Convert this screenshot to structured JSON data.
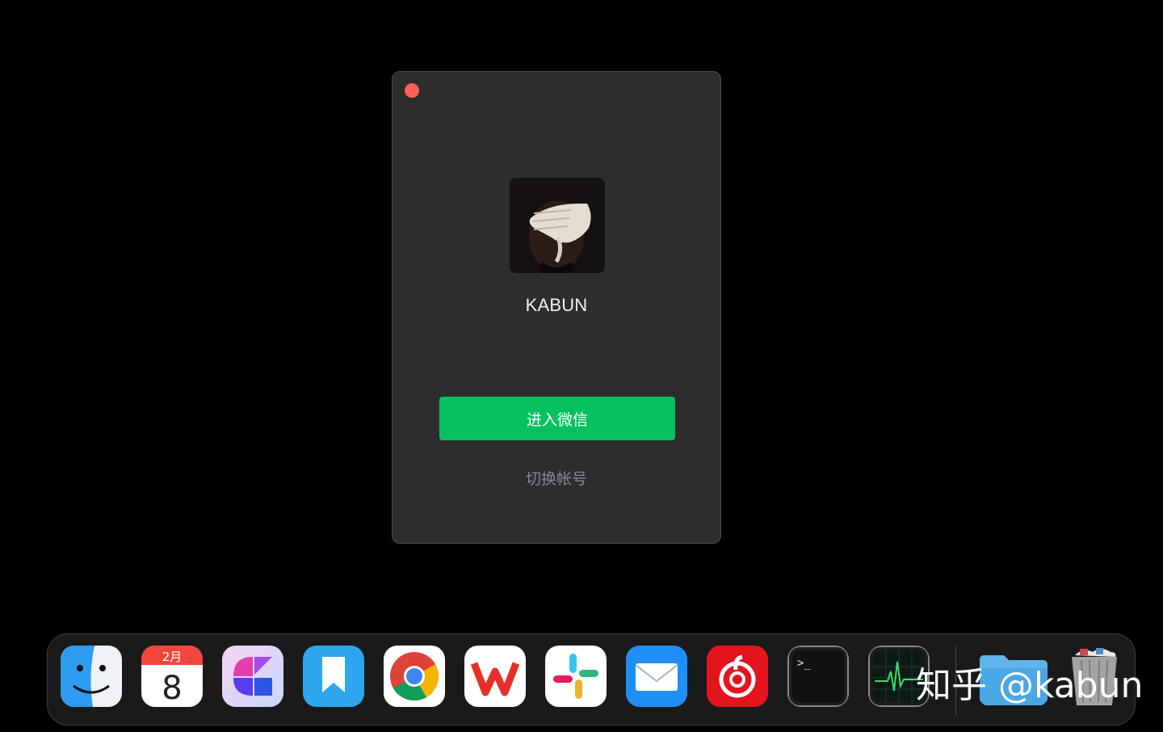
{
  "login_window": {
    "username": "KABUN",
    "enter_button_label": "进入微信",
    "switch_account_label": "切换帐号",
    "accent_color": "#07c160",
    "close_color": "#ff5f57"
  },
  "dock": {
    "items": [
      {
        "name": "finder-icon"
      },
      {
        "name": "calendar-icon",
        "month": "2月",
        "day": "8"
      },
      {
        "name": "craft-icon"
      },
      {
        "name": "bookmark-icon"
      },
      {
        "name": "chrome-icon"
      },
      {
        "name": "wps-icon"
      },
      {
        "name": "slack-icon"
      },
      {
        "name": "mail-icon"
      },
      {
        "name": "netease-music-icon"
      },
      {
        "name": "terminal-icon",
        "prompt": ">_"
      },
      {
        "name": "activity-monitor-icon"
      },
      {
        "name": "folder-icon"
      },
      {
        "name": "trash-icon"
      }
    ]
  },
  "watermark": "知乎 @kabun"
}
